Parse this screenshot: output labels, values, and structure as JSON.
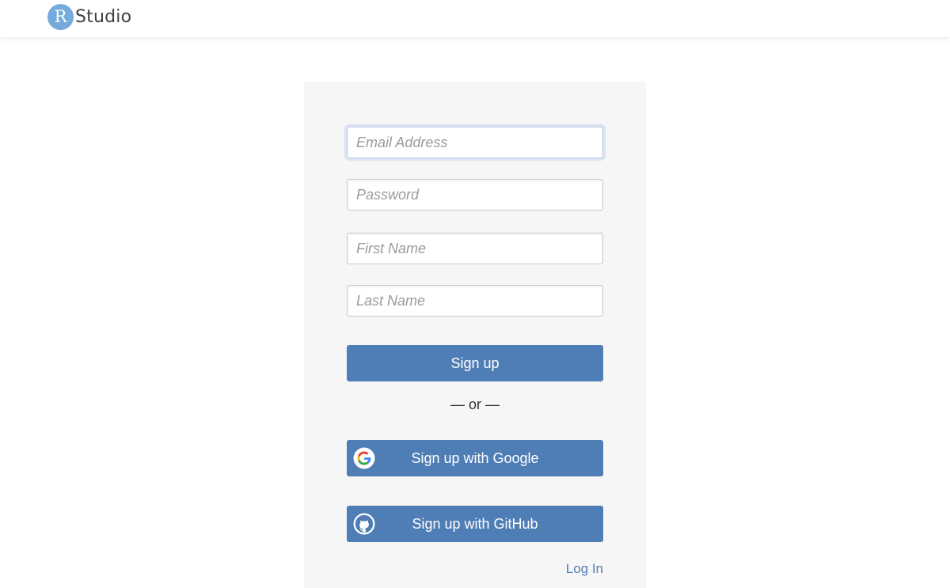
{
  "header": {
    "logo_letter": "R",
    "logo_text": "Studio",
    "logo_color": "#75aadb"
  },
  "form": {
    "email_placeholder": "Email Address",
    "email_value": "",
    "password_placeholder": "Password",
    "password_value": "",
    "first_name_placeholder": "First Name",
    "first_name_value": "",
    "last_name_placeholder": "Last Name",
    "last_name_value": "",
    "signup_label": "Sign up",
    "or_text": "— or —",
    "google_label": "Sign up with Google",
    "google_icon": "google-icon",
    "github_label": "Sign up with GitHub",
    "github_icon": "github-icon",
    "login_label": "Log In"
  },
  "colors": {
    "button_blue": "#4f7db5",
    "panel_bg": "#f6f6f6"
  }
}
